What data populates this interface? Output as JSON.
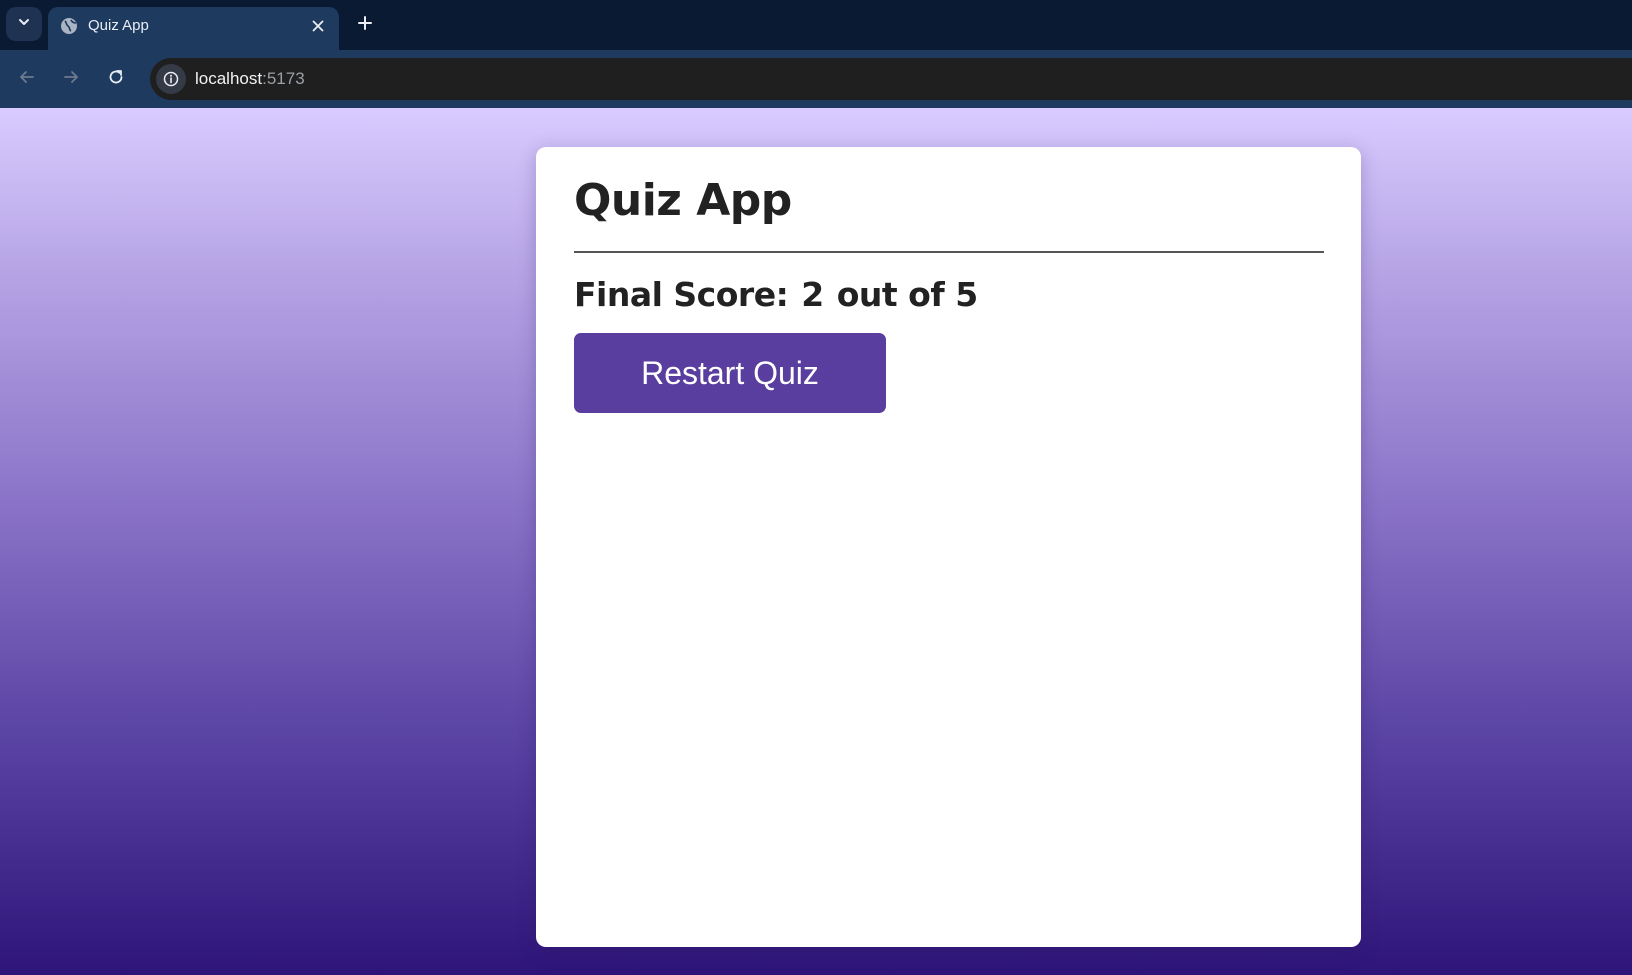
{
  "browser": {
    "tab": {
      "title": "Quiz App",
      "favicon_icon": "globe-icon"
    },
    "address_bar": {
      "host": "localhost",
      "port": ":5173"
    }
  },
  "app": {
    "title": "Quiz App",
    "result": {
      "label": "Final Score:",
      "score": "2",
      "connector": "out of",
      "total": "5"
    },
    "restart_label": "Restart Quiz"
  },
  "colors": {
    "accent": "#5a3e9f",
    "chrome_dark": "#0b1a33",
    "chrome_toolbar": "#1f3a5f",
    "gradient_top": "#d9cbff",
    "gradient_bottom": "#2e1478"
  }
}
